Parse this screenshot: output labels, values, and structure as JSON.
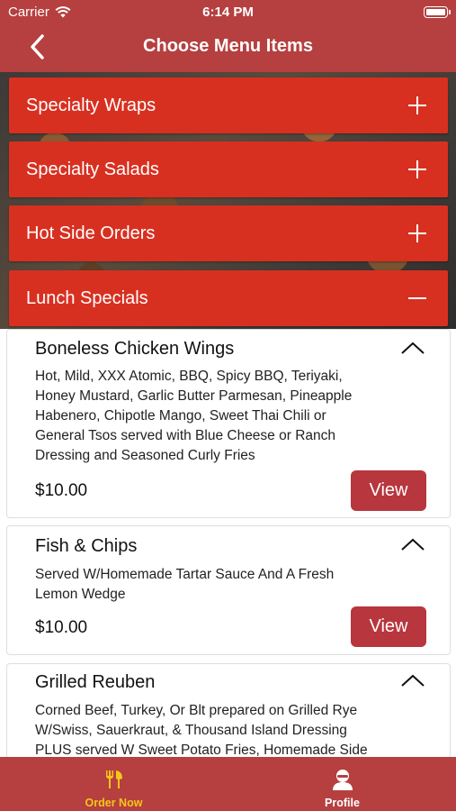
{
  "status_bar": {
    "carrier": "Carrier",
    "time": "6:14 PM"
  },
  "nav": {
    "title": "Choose Menu Items"
  },
  "categories": [
    {
      "label": "Specialty Wraps",
      "state": "collapsed"
    },
    {
      "label": "Specialty Salads",
      "state": "collapsed"
    },
    {
      "label": "Hot Side Orders",
      "state": "collapsed"
    },
    {
      "label": "Lunch Specials",
      "state": "expanded"
    }
  ],
  "items": [
    {
      "name": "Boneless Chicken Wings",
      "desc_lines": [
        "Hot, Mild, XXX Atomic, BBQ, Spicy BBQ, Teriyaki,",
        "Honey Mustard, Garlic Butter Parmesan, Pineapple",
        "Habenero, Chipotle Mango, Sweet Thai Chili or",
        "General Tsos served with Blue Cheese or Ranch",
        "Dressing and Seasoned Curly Fries"
      ],
      "price": "$10.00",
      "button": "View"
    },
    {
      "name": "Fish & Chips",
      "desc_lines": [
        "Served W/Homemade Tartar Sauce And A Fresh",
        "Lemon Wedge"
      ],
      "price": "$10.00",
      "button": "View"
    },
    {
      "name": "Grilled Reuben",
      "desc_lines": [
        "Corned Beef, Turkey, Or Blt prepared on Grilled Rye",
        "W/Swiss, Sauerkraut, & Thousand Island Dressing",
        "PLUS served W Sweet Potato Fries, Homemade Side"
      ]
    }
  ],
  "tabs": [
    {
      "label": "Order Now",
      "icon": "utensils-icon",
      "color": "#f5c518",
      "active": true
    },
    {
      "label": "Profile",
      "icon": "person-icon",
      "color": "#ffffff",
      "active": false
    }
  ],
  "colors": {
    "header": "#b5403f",
    "category": "#d83020",
    "view_button": "#b8363d",
    "active_tab": "#f5c518"
  }
}
